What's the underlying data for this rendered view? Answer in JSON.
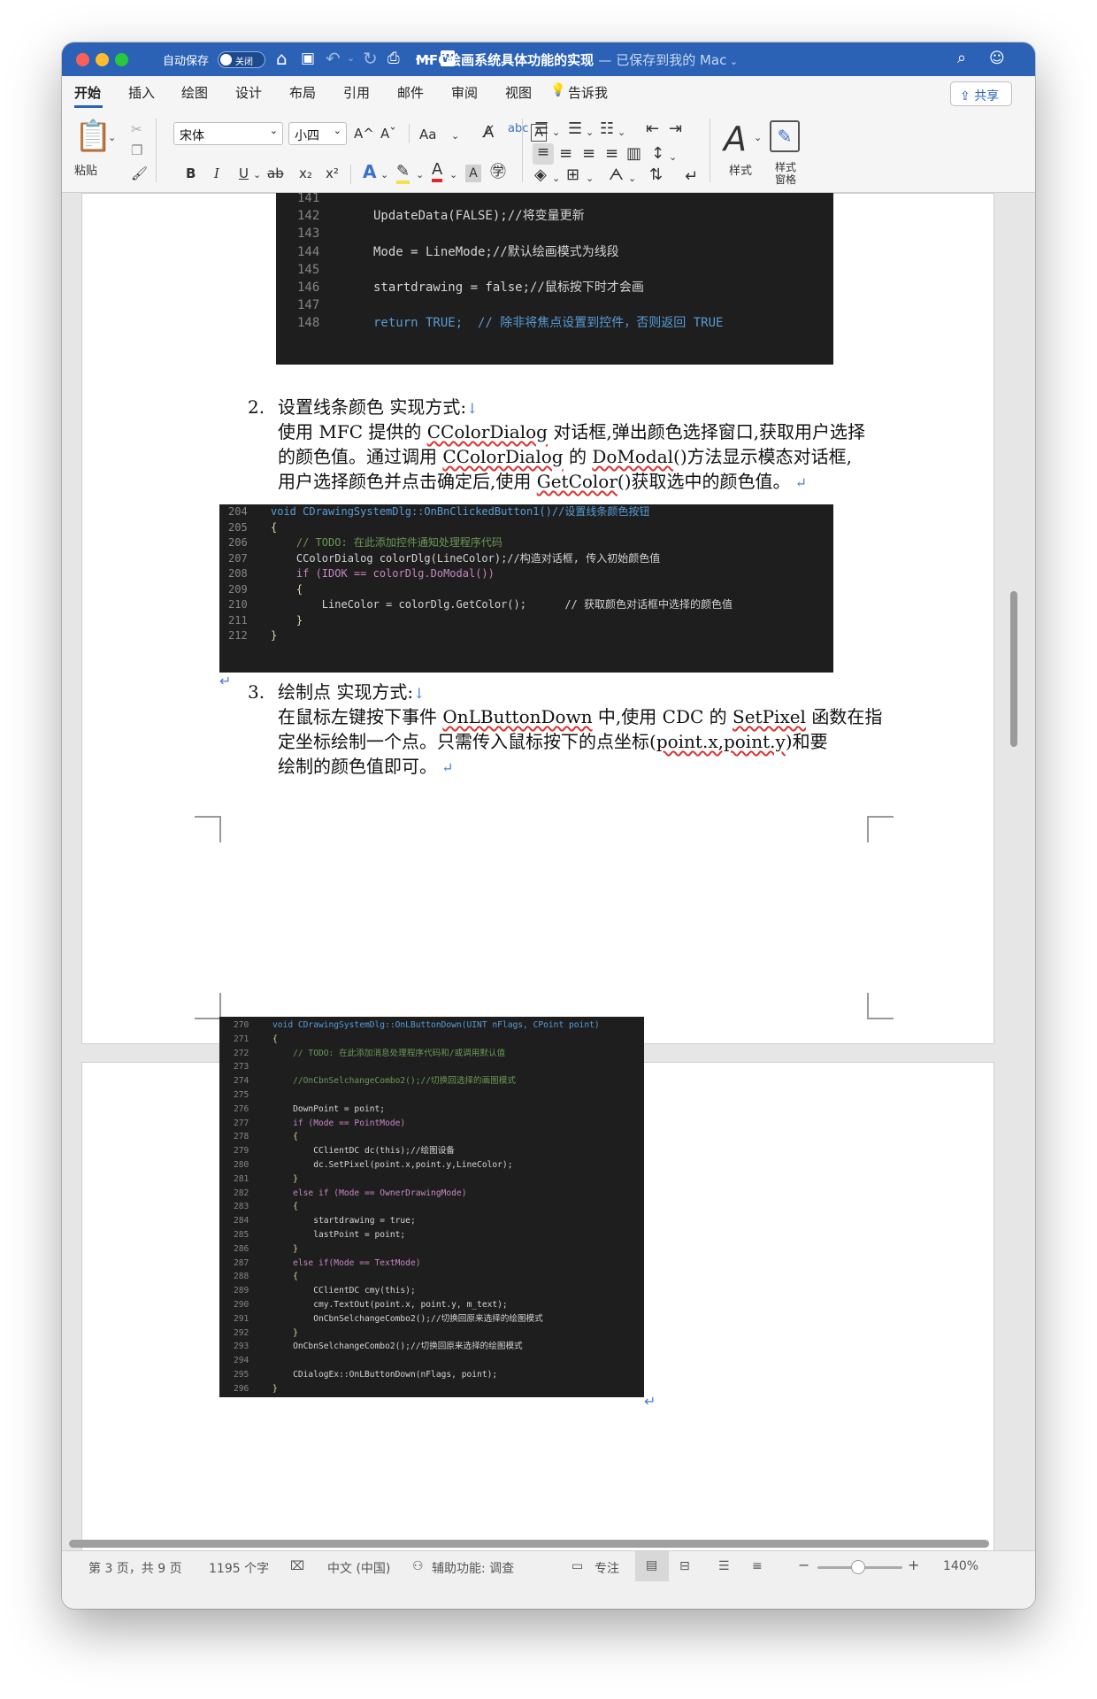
{
  "titlebar": {
    "autosave_label": "自动保存",
    "autosave_state": "关闭",
    "doc_title": "MFC绘画系统具体功能的实现",
    "saved_status": "— 已保存到我的 Mac",
    "word_badge": "W"
  },
  "tabs": [
    {
      "label": "开始"
    },
    {
      "label": "插入"
    },
    {
      "label": "绘图"
    },
    {
      "label": "设计"
    },
    {
      "label": "布局"
    },
    {
      "label": "引用"
    },
    {
      "label": "邮件"
    },
    {
      "label": "审阅"
    },
    {
      "label": "视图"
    },
    {
      "label": "告诉我"
    }
  ],
  "share_label": "共享",
  "ribbon": {
    "paste_label": "粘贴",
    "font_name": "宋体",
    "font_size": "小四",
    "styles_label": "样式",
    "styles_pane_label": "样式\n窗格",
    "bold": "B",
    "italic": "I",
    "underline": "U",
    "strike": "ab",
    "subscript": "x₂",
    "superscript": "x²",
    "grow": "A^",
    "shrink": "Aˇ",
    "change_case": "Aa"
  },
  "code1": [
    {
      "n": "141",
      "t": ""
    },
    {
      "n": "142",
      "t": "UpdateData(FALSE);//将变量更新"
    },
    {
      "n": "143",
      "t": ""
    },
    {
      "n": "144",
      "t": "Mode = LineMode;//默认绘画模式为线段"
    },
    {
      "n": "145",
      "t": ""
    },
    {
      "n": "146",
      "t": "startdrawing = false;//鼠标按下时才会画"
    },
    {
      "n": "147",
      "t": ""
    },
    {
      "n": "148",
      "t": "return TRUE;  // 除非将焦点设置到控件，否则返回 TRUE"
    }
  ],
  "section2": {
    "num": "2.",
    "heading": "设置线条颜色  实现方式:",
    "line1_a": "使用 MFC 提供的 ",
    "line1_b": "CColorDialog",
    "line1_c": " 对话框,弹出颜色选择窗口,获取用户选择",
    "line2_a": "的颜色值。通过调用 ",
    "line2_b": "CColorDialog",
    "line2_c": " 的 ",
    "line2_d": "DoModal",
    "line2_e": "()方法显示模态对话框,",
    "line3_a": "用户选择颜色并点击确定后,使用 ",
    "line3_b": "GetColor",
    "line3_c": "()获取选中的颜色值。"
  },
  "code2": [
    {
      "n": "204",
      "t": "void CDrawingSystemDlg::OnBnClickedButton1()//设置线条颜色按钮"
    },
    {
      "n": "205",
      "t": "{"
    },
    {
      "n": "206",
      "t": "    // TODO: 在此添加控件通知处理程序代码"
    },
    {
      "n": "207",
      "t": "    CColorDialog colorDlg(LineColor);//构造对话框, 传入初始颜色值"
    },
    {
      "n": "208",
      "t": "    if (IDOK == colorDlg.DoModal())"
    },
    {
      "n": "209",
      "t": "    {"
    },
    {
      "n": "210",
      "t": "        LineColor = colorDlg.GetColor();      // 获取颜色对话框中选择的颜色值"
    },
    {
      "n": "211",
      "t": "    }"
    },
    {
      "n": "212",
      "t": "}"
    }
  ],
  "section3": {
    "num": "3.",
    "heading": "绘制点  实现方式:",
    "line1_a": "在鼠标左键按下事件 ",
    "line1_b": "OnLButtonDown",
    "line1_c": " 中,使用 CDC 的 ",
    "line1_d": "SetPixel",
    "line1_e": " 函数在指",
    "line2": "定坐标绘制一个点。只需传入鼠标按下的点坐标(",
    "line2_b": "point.x,point.y",
    "line2_c": ")和要",
    "line3": "绘制的颜色值即可。"
  },
  "code3": [
    {
      "n": "270",
      "t": "void CDrawingSystemDlg::OnLButtonDown(UINT nFlags, CPoint point)"
    },
    {
      "n": "271",
      "t": "{"
    },
    {
      "n": "272",
      "t": "    // TODO: 在此添加消息处理程序代码和/或调用默认值"
    },
    {
      "n": "273",
      "t": ""
    },
    {
      "n": "274",
      "t": "    //OnCbnSelchangeCombo2();//切换回选择的画图模式"
    },
    {
      "n": "275",
      "t": ""
    },
    {
      "n": "276",
      "t": "    DownPoint = point;"
    },
    {
      "n": "277",
      "t": "    if (Mode == PointMode)"
    },
    {
      "n": "278",
      "t": "    {"
    },
    {
      "n": "279",
      "t": "        CClientDC dc(this);//绘图设备"
    },
    {
      "n": "280",
      "t": "        dc.SetPixel(point.x,point.y,LineColor);"
    },
    {
      "n": "281",
      "t": "    }"
    },
    {
      "n": "282",
      "t": "    else if (Mode == OwnerDrawingMode)"
    },
    {
      "n": "283",
      "t": "    {"
    },
    {
      "n": "284",
      "t": "        startdrawing = true;"
    },
    {
      "n": "285",
      "t": "        lastPoint = point;"
    },
    {
      "n": "286",
      "t": "    }"
    },
    {
      "n": "287",
      "t": "    else if(Mode == TextMode)"
    },
    {
      "n": "288",
      "t": "    {"
    },
    {
      "n": "289",
      "t": "        CClientDC cmy(this);"
    },
    {
      "n": "290",
      "t": "        cmy.TextOut(point.x, point.y, m_text);"
    },
    {
      "n": "291",
      "t": "        OnCbnSelchangeCombo2();//切换回原来选择的绘图模式"
    },
    {
      "n": "292",
      "t": "    }"
    },
    {
      "n": "293",
      "t": "    OnCbnSelchangeCombo2();//切换回原来选择的绘图模式"
    },
    {
      "n": "294",
      "t": ""
    },
    {
      "n": "295",
      "t": "    CDialogEx::OnLButtonDown(nFlags, point);"
    },
    {
      "n": "296",
      "t": "}"
    }
  ],
  "status": {
    "page": "第 3 页，共 9 页",
    "words": "1195 个字",
    "language": "中文 (中国)",
    "accessibility": "辅助功能: 调查",
    "focus": "专注",
    "zoom": "140%"
  },
  "colors": {
    "accent": "#2b62b6",
    "code_bg": "#1e1e1e",
    "keyword": "#569cd6",
    "comment": "#6a9955",
    "func": "#dcdcaa",
    "control": "#c586c0",
    "number": "#b5cea8"
  }
}
